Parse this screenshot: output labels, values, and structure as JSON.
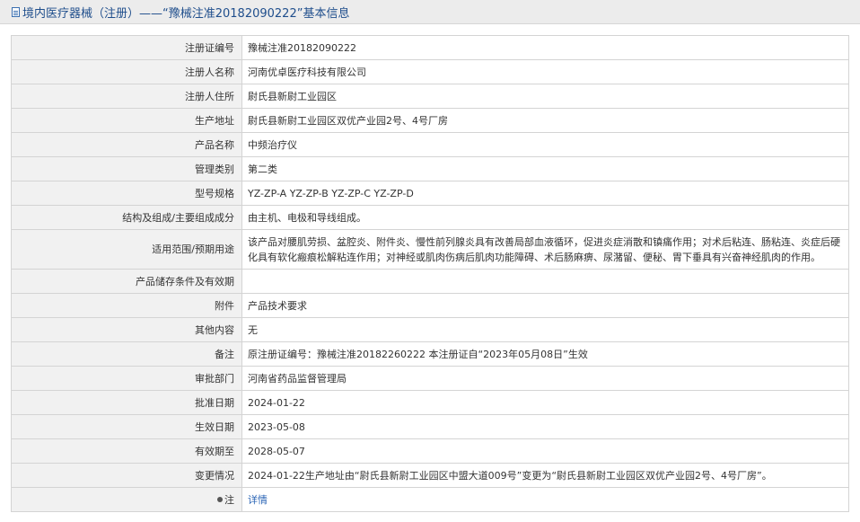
{
  "header": {
    "title": "境内医疗器械（注册）——“豫械注准20182090222”基本信息"
  },
  "rows": [
    {
      "label": "注册证编号",
      "value": "豫械注准20182090222"
    },
    {
      "label": "注册人名称",
      "value": "河南优卓医疗科技有限公司"
    },
    {
      "label": "注册人住所",
      "value": "尉氏县新尉工业园区"
    },
    {
      "label": "生产地址",
      "value": "尉氏县新尉工业园区双优产业园2号、4号厂房"
    },
    {
      "label": "产品名称",
      "value": "中频治疗仪"
    },
    {
      "label": "管理类别",
      "value": "第二类"
    },
    {
      "label": "型号规格",
      "value": "YZ-ZP-A YZ-ZP-B YZ-ZP-C YZ-ZP-D"
    },
    {
      "label": "结构及组成/主要组成成分",
      "value": "由主机、电极和导线组成。"
    },
    {
      "label": "适用范围/预期用途",
      "value": "该产品对腰肌劳损、盆腔炎、附件炎、慢性前列腺炎具有改善局部血液循环，促进炎症消散和镇痛作用；对术后粘连、肠粘连、炎症后硬化具有软化瘢痕松解粘连作用；对神经或肌肉伤病后肌肉功能障碍、术后肠麻痹、尿潴留、便秘、胃下垂具有兴奋神经肌肉的作用。"
    },
    {
      "label": "产品储存条件及有效期",
      "value": ""
    },
    {
      "label": "附件",
      "value": "产品技术要求"
    },
    {
      "label": "其他内容",
      "value": "无"
    },
    {
      "label": "备注",
      "value": "原注册证编号：豫械注准20182260222 本注册证自“2023年05月08日”生效"
    },
    {
      "label": "审批部门",
      "value": "河南省药品监督管理局"
    },
    {
      "label": "批准日期",
      "value": "2024-01-22"
    },
    {
      "label": "生效日期",
      "value": "2023-05-08"
    },
    {
      "label": "有效期至",
      "value": "2028-05-07"
    },
    {
      "label": "变更情况",
      "value": "2024-01-22生产地址由“尉氏县新尉工业园区中盟大道009号”变更为“尉氏县新尉工业园区双优产业园2号、4号厂房”。"
    }
  ],
  "note": {
    "label": "注",
    "link": "详情",
    "icon": "pin-icon"
  }
}
